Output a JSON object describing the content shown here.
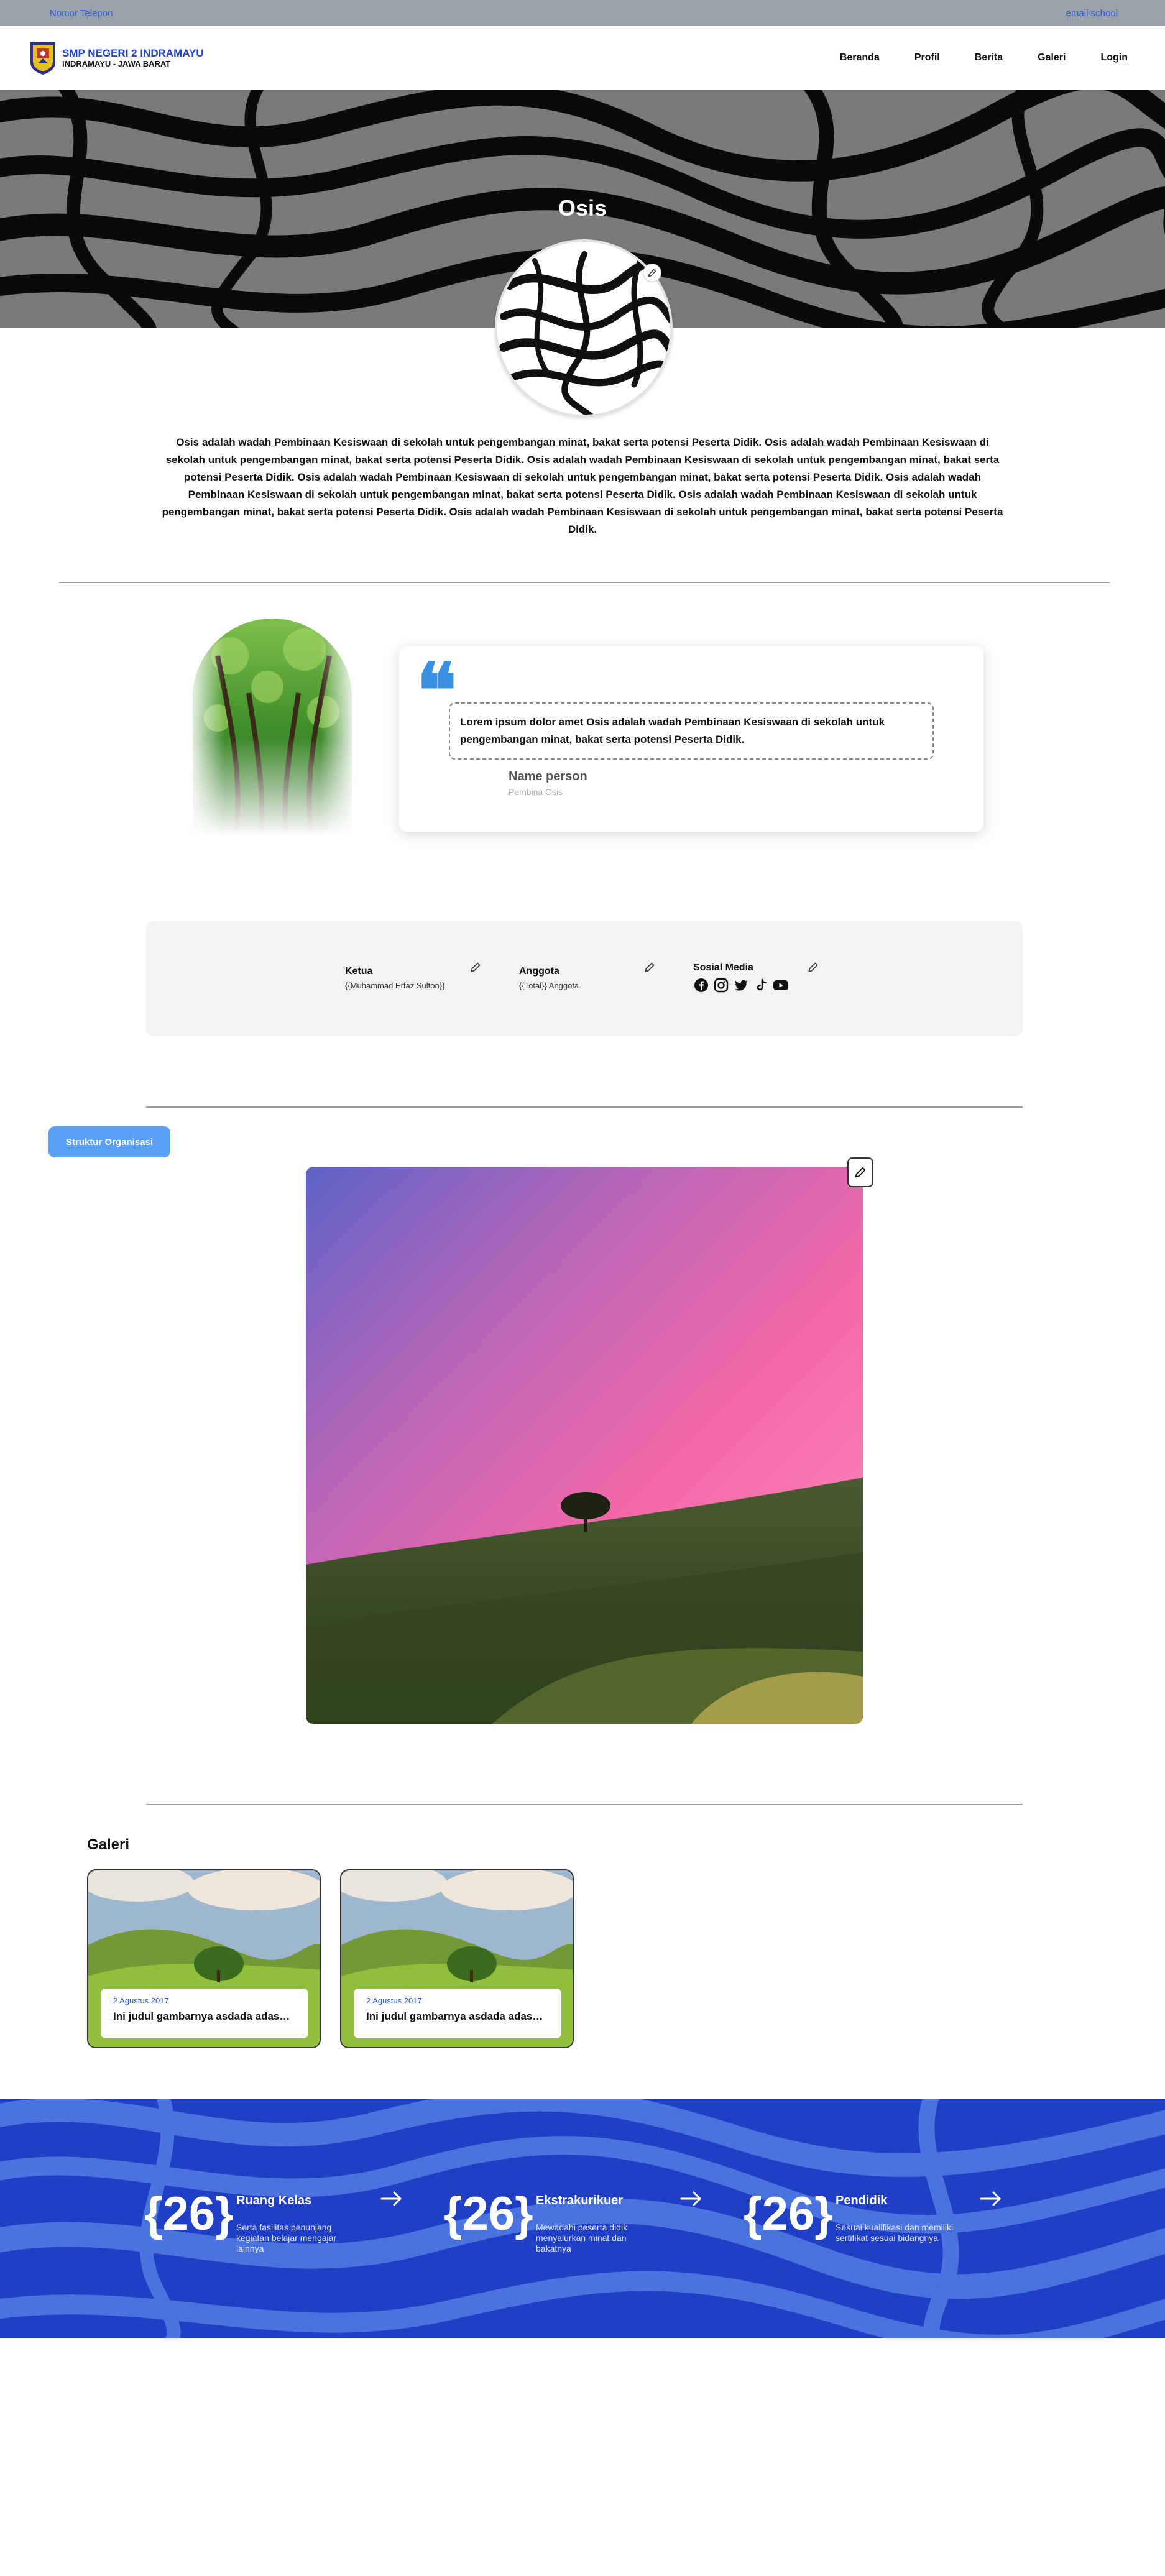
{
  "topbar": {
    "phone": "Nomor Telepon",
    "email": "email school"
  },
  "brand": {
    "line1": "SMP NEGERI 2 INDRAMAYU",
    "line2": "INDRAMAYU - JAWA BARAT"
  },
  "nav": [
    "Beranda",
    "Profil",
    "Berita",
    "Galeri",
    "Login"
  ],
  "hero": {
    "title": "Osis"
  },
  "description": "Osis adalah wadah Pembinaan Kesiswaan di sekolah untuk pengembangan minat, bakat serta potensi Peserta Didik. Osis adalah wadah Pembinaan Kesiswaan di sekolah untuk pengembangan minat, bakat serta potensi Peserta Didik. Osis adalah wadah Pembinaan Kesiswaan di sekolah untuk pengembangan minat, bakat serta potensi Peserta Didik. Osis adalah wadah Pembinaan Kesiswaan di sekolah untuk pengembangan minat, bakat serta potensi Peserta Didik. Osis adalah wadah Pembinaan Kesiswaan di sekolah untuk pengembangan minat, bakat serta potensi Peserta Didik. Osis adalah wadah Pembinaan Kesiswaan di sekolah untuk pengembangan minat, bakat serta potensi Peserta Didik. Osis adalah wadah Pembinaan Kesiswaan di sekolah untuk pengembangan minat, bakat serta potensi Peserta Didik.",
  "quote": {
    "text": "Lorem ipsum dolor amet Osis adalah wadah Pembinaan Kesiswaan di sekolah untuk pengembangan minat, bakat serta potensi Peserta Didik.",
    "name": "Name person",
    "role": "Pembina Osis"
  },
  "info": {
    "ketua_label": "Ketua",
    "ketua_value": "{{Muhammad Erfaz Sulton}}",
    "anggota_label": "Anggota",
    "anggota_value": "{{Total}} Anggota",
    "sosmed_label": "Sosial Media",
    "sosmed_icons": [
      "facebook-icon",
      "instagram-icon",
      "twitter-icon",
      "tiktok-icon",
      "youtube-icon"
    ]
  },
  "struktur": {
    "button": "Struktur Organisasi"
  },
  "galeri": {
    "title": "Galeri",
    "items": [
      {
        "date": "2 Agustus 2017",
        "title": "Ini judul gambarnya asdada adasdasd"
      },
      {
        "date": "2 Agustus 2017",
        "title": "Ini judul gambarnya asdada adasdasd"
      }
    ]
  },
  "stats": [
    {
      "number": "{26}",
      "label": "Ruang Kelas",
      "desc": "Serta fasilitas penunjang kegiatan belajar mengajar lainnya"
    },
    {
      "number": "{26}",
      "label": "Ekstrakurikuer",
      "desc": "Mewadahi peserta didik menyalurkan minat dan bakatnya"
    },
    {
      "number": "{26}",
      "label": "Pendidik",
      "desc": "Sesuai kualifikasi dan memiliki sertifikat sesuai bidangnya"
    }
  ],
  "colors": {
    "accent": "#2243c9",
    "button": "#5aa0f5",
    "quote": "#3b8fe0",
    "stats_bg": "#1f3fc4",
    "topbar_bg": "#9ba1ab"
  }
}
